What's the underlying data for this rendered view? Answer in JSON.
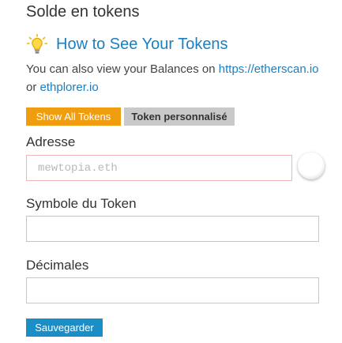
{
  "section": {
    "title": "Solde en tokens"
  },
  "help": {
    "icon": "lightbulb-icon",
    "title": "How to See Your Tokens",
    "text_before": "You can also view your Balances on ",
    "link_etherscan": "https://etherscan.io",
    "text_or": " or ",
    "link_ethplorer": "ethplorer.io"
  },
  "tabs": {
    "show_all_label": "Show All Tokens",
    "custom_label": "Token personnalisé"
  },
  "form": {
    "address_label": "Adresse",
    "address_placeholder": "mewtopia.eth",
    "address_value": "",
    "symbol_label": "Symbole du Token",
    "symbol_value": "",
    "decimals_label": "Décimales",
    "decimals_value": "",
    "save_label": "Sauvegarder"
  },
  "colors": {
    "show_all_bg": "#f09c0f",
    "custom_bg": "#c9c9c9",
    "link": "#1a7fc0",
    "save_bg": "#1a8fc7",
    "input_border": "#f0b4b4"
  }
}
